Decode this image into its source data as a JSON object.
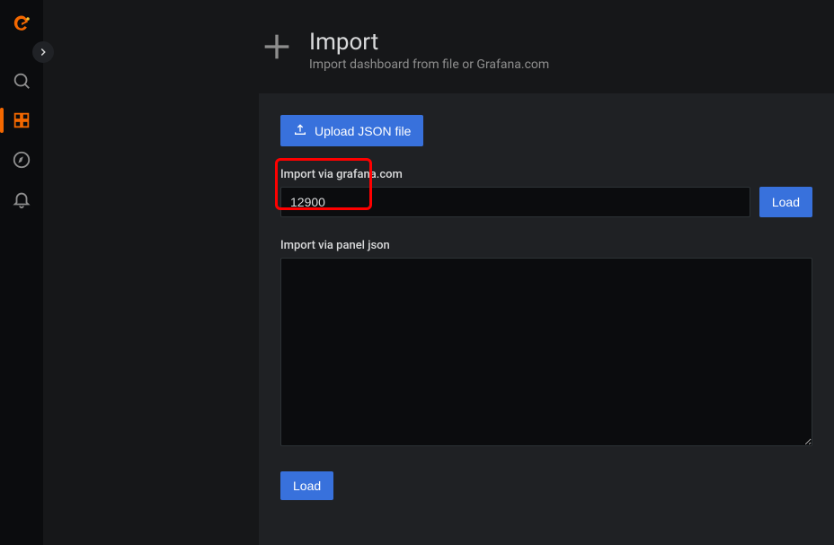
{
  "page": {
    "title": "Import",
    "subtitle": "Import dashboard from file or Grafana.com"
  },
  "buttons": {
    "upload": "Upload JSON file",
    "load_grafana": "Load",
    "load_json": "Load"
  },
  "labels": {
    "via_grafana": "Import via grafana.com",
    "via_panel_json": "Import via panel json"
  },
  "inputs": {
    "grafana_id": "12900",
    "panel_json": ""
  }
}
